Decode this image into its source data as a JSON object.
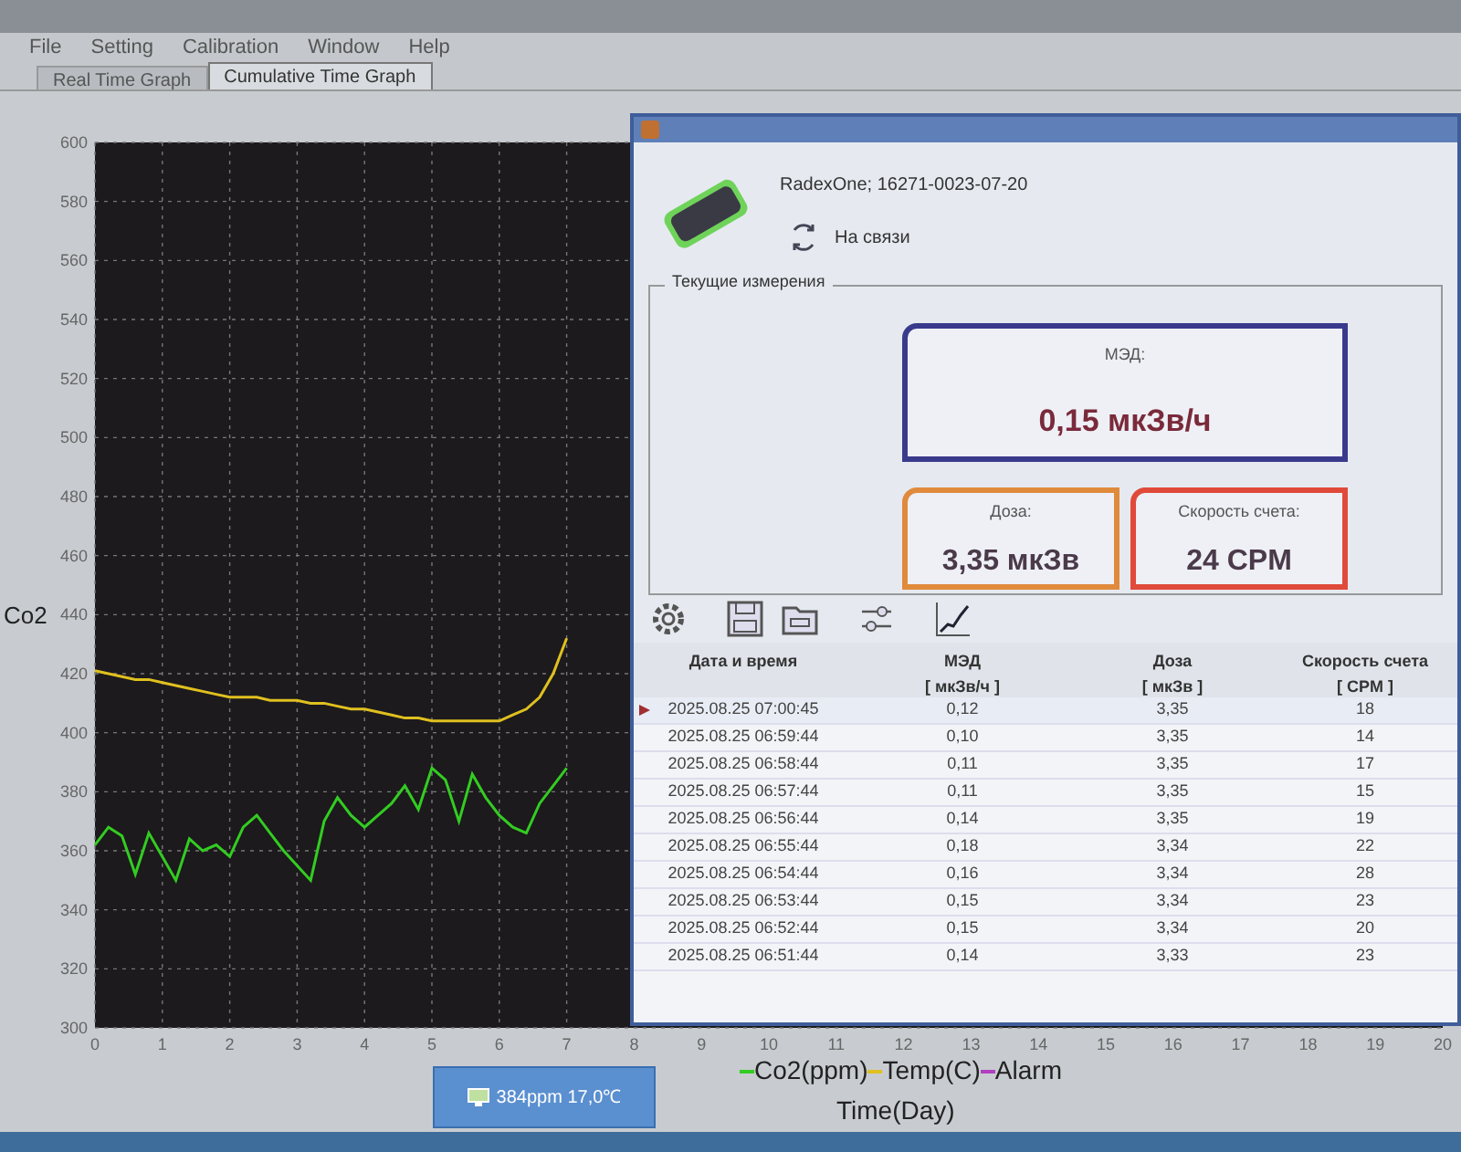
{
  "menu": [
    "File",
    "Setting",
    "Calibration",
    "Window",
    "Help"
  ],
  "tabs": [
    {
      "label": "Real Time Graph",
      "selected": false
    },
    {
      "label": "Cumulative Time Graph",
      "selected": true
    }
  ],
  "graph": {
    "tooltip": "384ppm 17,0℃",
    "chart_data": {
      "type": "line",
      "xlabel": "Time(Day)",
      "ylabel": "Co2",
      "grid": true,
      "x": [
        0,
        0.2,
        0.4,
        0.6,
        0.8,
        1,
        1.2,
        1.4,
        1.6,
        1.8,
        2,
        2.2,
        2.4,
        2.6,
        2.8,
        3,
        3.2,
        3.4,
        3.6,
        3.8,
        4,
        4.2,
        4.4,
        4.6,
        4.8,
        5,
        5.2,
        5.4,
        5.6,
        5.8,
        6,
        6.2,
        6.4,
        6.6,
        6.8,
        7
      ],
      "series": [
        {
          "name": "Co2(ppm)",
          "color": "#33cc22",
          "values": [
            362,
            368,
            365,
            352,
            366,
            358,
            350,
            364,
            360,
            362,
            358,
            368,
            372,
            366,
            360,
            355,
            350,
            370,
            378,
            372,
            368,
            372,
            376,
            382,
            374,
            388,
            384,
            370,
            386,
            378,
            372,
            368,
            366,
            376,
            382,
            388
          ]
        },
        {
          "name": "Temp(C)",
          "color": "#e0c020",
          "values": [
            421,
            420,
            419,
            418,
            418,
            417,
            416,
            415,
            414,
            413,
            412,
            412,
            412,
            411,
            411,
            411,
            410,
            410,
            409,
            408,
            408,
            407,
            406,
            405,
            405,
            404,
            404,
            404,
            404,
            404,
            404,
            406,
            408,
            412,
            420,
            432
          ]
        },
        {
          "name": "Alarm",
          "color": "#b040c0",
          "values": [
            null,
            null,
            null,
            null,
            null,
            null,
            null,
            null,
            null,
            null,
            null,
            null,
            null,
            null,
            null,
            null,
            null,
            null,
            null,
            null,
            null,
            null,
            null,
            null,
            null,
            null,
            null,
            null,
            null,
            null,
            null,
            null,
            null,
            null,
            null,
            null
          ]
        }
      ],
      "xlim": [
        0,
        20
      ],
      "ylim": [
        300,
        600
      ],
      "xticks": [
        0,
        1,
        2,
        3,
        4,
        5,
        6,
        7,
        8,
        9,
        10,
        11,
        12,
        13,
        14,
        15,
        16,
        17,
        18,
        19,
        20
      ],
      "yticks": [
        300,
        320,
        340,
        360,
        380,
        400,
        420,
        440,
        460,
        480,
        500,
        520,
        540,
        560,
        580,
        600
      ]
    }
  },
  "dialog": {
    "device": "RadexOne; 16271-0023-07-20",
    "status": "На связи",
    "group_title": "Текущие измерения",
    "cards": [
      {
        "kind": "main",
        "label": "МЭД:",
        "value": "0,15 мкЗв/ч",
        "color": "#3a3a8c"
      },
      {
        "kind": "small",
        "label": "Доза:",
        "value": "3,35 мкЗв",
        "color": "#e08a3c"
      },
      {
        "kind": "small",
        "label": "Скорость счета:",
        "value": "24 CPM",
        "color": "#e04a3a"
      }
    ],
    "table": {
      "columns": [
        {
          "title": "Дата и время"
        },
        {
          "title": "МЭД",
          "unit": "[ мкЗв/ч ]"
        },
        {
          "title": "Доза",
          "unit": "[ мкЗв ]"
        },
        {
          "title": "Скорость счета",
          "unit": "[ CPM ]"
        }
      ],
      "rows": [
        {
          "selected": true,
          "cells": [
            "2025.08.25 07:00:45",
            "0,12",
            "3,35",
            "18"
          ]
        },
        {
          "selected": false,
          "cells": [
            "2025.08.25 06:59:44",
            "0,10",
            "3,35",
            "14"
          ]
        },
        {
          "selected": false,
          "cells": [
            "2025.08.25 06:58:44",
            "0,11",
            "3,35",
            "17"
          ]
        },
        {
          "selected": false,
          "cells": [
            "2025.08.25 06:57:44",
            "0,11",
            "3,35",
            "15"
          ]
        },
        {
          "selected": false,
          "cells": [
            "2025.08.25 06:56:44",
            "0,14",
            "3,35",
            "19"
          ]
        },
        {
          "selected": false,
          "cells": [
            "2025.08.25 06:55:44",
            "0,18",
            "3,34",
            "22"
          ]
        },
        {
          "selected": false,
          "cells": [
            "2025.08.25 06:54:44",
            "0,16",
            "3,34",
            "28"
          ]
        },
        {
          "selected": false,
          "cells": [
            "2025.08.25 06:53:44",
            "0,15",
            "3,34",
            "23"
          ]
        },
        {
          "selected": false,
          "cells": [
            "2025.08.25 06:52:44",
            "0,15",
            "3,34",
            "20"
          ]
        },
        {
          "selected": false,
          "cells": [
            "2025.08.25 06:51:44",
            "0,14",
            "3,33",
            "23"
          ]
        }
      ]
    }
  }
}
